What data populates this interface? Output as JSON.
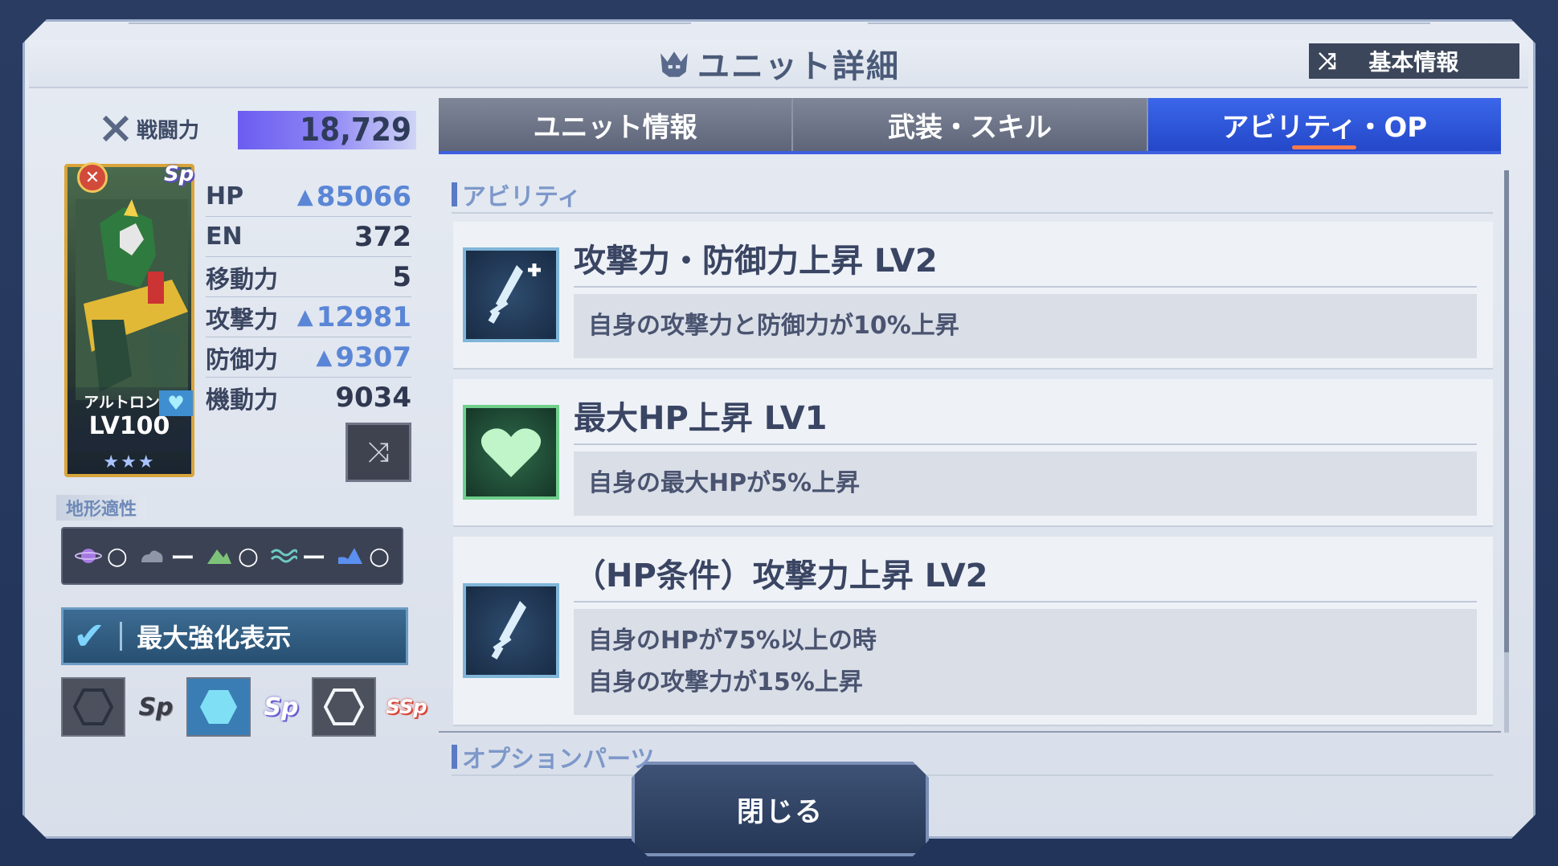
{
  "header": {
    "title": "ユニット詳細",
    "basic_info_button": "基本情報"
  },
  "power": {
    "label": "戦闘力",
    "value": "18,729"
  },
  "unit": {
    "name": "アルトロンガ",
    "level": "LV100",
    "stars": "★★★",
    "sp_badge": "Sp"
  },
  "stats": [
    {
      "label": "HP",
      "value": "85066",
      "boosted": true
    },
    {
      "label": "EN",
      "value": "372",
      "boosted": false
    },
    {
      "label": "移動力",
      "value": "5",
      "boosted": false
    },
    {
      "label": "攻撃力",
      "value": "12981",
      "boosted": true
    },
    {
      "label": "防御力",
      "value": "9307",
      "boosted": true
    },
    {
      "label": "機動力",
      "value": "9034",
      "boosted": false
    }
  ],
  "terrain": {
    "label": "地形適性",
    "items": [
      {
        "icon": "space-planet-icon",
        "value": "○"
      },
      {
        "icon": "air-cloud-icon",
        "value": "ー"
      },
      {
        "icon": "ground-mountain-icon",
        "value": "○"
      },
      {
        "icon": "water-wave-icon",
        "value": "ー"
      },
      {
        "icon": "underwater-icon",
        "value": "○"
      }
    ]
  },
  "max_enhance": {
    "label": "最大強化表示",
    "checked": true
  },
  "parts": {
    "sp_labels": [
      "Sp",
      "Sp",
      "SSp"
    ]
  },
  "tabs": [
    {
      "label": "ユニット情報",
      "active": false
    },
    {
      "label": "武装・スキル",
      "active": false
    },
    {
      "label": "アビリティ・OP",
      "active": true
    }
  ],
  "abilities_section": {
    "title": "アビリティ",
    "items": [
      {
        "name": "攻撃力・防御力上昇 LV2",
        "desc_lines": [
          "自身の攻撃力と防御力が10%上昇"
        ],
        "icon": "sword-plus-icon"
      },
      {
        "name": "最大HP上昇 LV1",
        "desc_lines": [
          "自身の最大HPが5%上昇"
        ],
        "icon": "heart-icon"
      },
      {
        "name": "（HP条件）攻撃力上昇 LV2",
        "desc_lines": [
          "自身のHPが75%以上の時",
          "自身の攻撃力が15%上昇"
        ],
        "icon": "sword-icon"
      }
    ]
  },
  "option_parts_section": {
    "title": "オプションパーツ"
  },
  "close_button": "閉じる",
  "colors": {
    "active_tab": "#2f55d8",
    "inactive_tab": "#6e7589",
    "accent_underline": "#ff7a4a",
    "power_bar": "#7a6cf2"
  }
}
